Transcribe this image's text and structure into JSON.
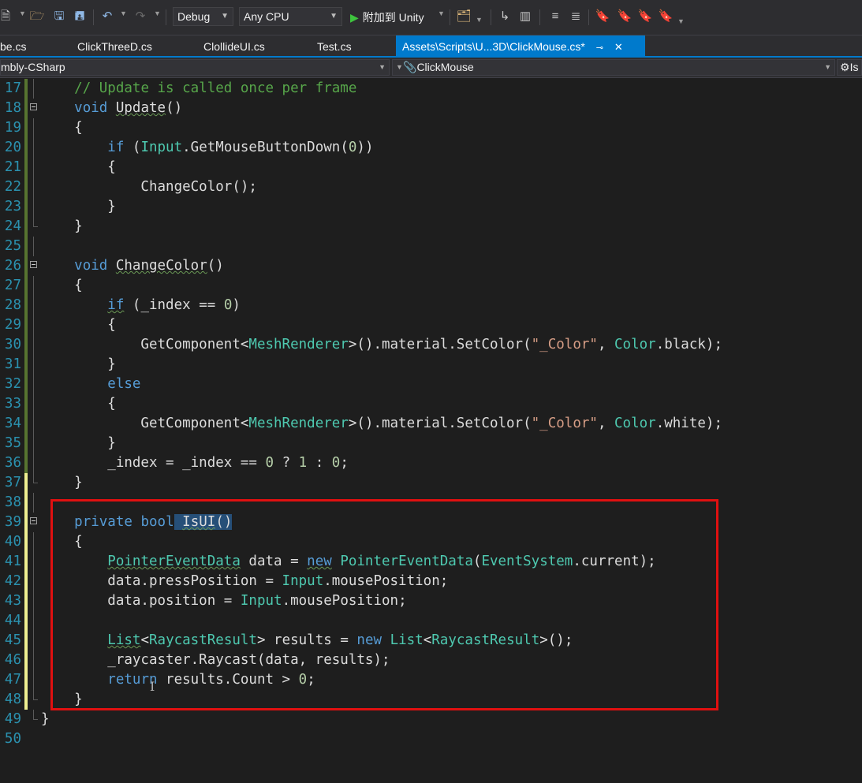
{
  "toolbar": {
    "config": "Debug",
    "platform": "Any CPU",
    "attach_label": "附加到 Unity",
    "icons": [
      "new-project-icon",
      "open-folder-icon",
      "save-icon",
      "save-all-icon",
      "undo-icon",
      "redo-icon",
      "attach-play-icon",
      "device-icon",
      "step-icon",
      "layout-icon",
      "comment-icon",
      "uncomment-icon",
      "bookmark-icon",
      "prev-bookmark-icon",
      "next-bookmark-icon",
      "clear-bookmark-icon"
    ]
  },
  "tabs": [
    {
      "label": "be.cs",
      "active": false
    },
    {
      "label": "ClickThreeD.cs",
      "active": false
    },
    {
      "label": "ClollideUI.cs",
      "active": false
    },
    {
      "label": "Test.cs",
      "active": false
    },
    {
      "label": "Assets\\Scripts\\U...3D\\ClickMouse.cs*",
      "active": true
    }
  ],
  "navbar": {
    "project": "mbly-CSharp",
    "class": "ClickMouse",
    "member": "Is"
  },
  "colors": {
    "background": "#1e1e1e",
    "keyword": "#569cd6",
    "comment": "#57a64a",
    "type": "#4ec9b0",
    "string": "#d69d85",
    "number": "#b5cea8",
    "line_number": "#2b91af",
    "accent": "#007acc",
    "highlight_box": "#e01010"
  },
  "code": [
    {
      "n": "17",
      "change": "saved",
      "fold": false,
      "guide": "line",
      "tokens": [
        {
          "t": "    "
        },
        {
          "t": "// Update is called once per frame",
          "c": "cm"
        }
      ]
    },
    {
      "n": "18",
      "change": "saved",
      "fold": true,
      "guide": "none",
      "tokens": [
        {
          "t": "    "
        },
        {
          "t": "void",
          "c": "kw"
        },
        {
          "t": " "
        },
        {
          "t": "Update",
          "c": "squig"
        },
        {
          "t": "()"
        }
      ]
    },
    {
      "n": "19",
      "change": "saved",
      "fold": false,
      "guide": "line",
      "tokens": [
        {
          "t": "    {"
        }
      ]
    },
    {
      "n": "20",
      "change": "saved",
      "fold": false,
      "guide": "line",
      "tokens": [
        {
          "t": "        "
        },
        {
          "t": "if",
          "c": "kw"
        },
        {
          "t": " ("
        },
        {
          "t": "Input",
          "c": "ty"
        },
        {
          "t": ".GetMouseButtonDown("
        },
        {
          "t": "0",
          "c": "nm"
        },
        {
          "t": "))"
        }
      ]
    },
    {
      "n": "21",
      "change": "saved",
      "fold": false,
      "guide": "line",
      "tokens": [
        {
          "t": "        {"
        }
      ]
    },
    {
      "n": "22",
      "change": "saved",
      "fold": false,
      "guide": "line",
      "tokens": [
        {
          "t": "            ChangeColor();"
        }
      ]
    },
    {
      "n": "23",
      "change": "saved",
      "fold": false,
      "guide": "line",
      "tokens": [
        {
          "t": "        }"
        }
      ]
    },
    {
      "n": "24",
      "change": "saved",
      "fold": false,
      "guide": "end",
      "tokens": [
        {
          "t": "    }"
        }
      ]
    },
    {
      "n": "25",
      "change": "saved",
      "fold": false,
      "guide": "line",
      "tokens": []
    },
    {
      "n": "26",
      "change": "saved",
      "fold": true,
      "guide": "none",
      "tokens": [
        {
          "t": "    "
        },
        {
          "t": "void",
          "c": "kw"
        },
        {
          "t": " "
        },
        {
          "t": "ChangeColor",
          "c": "squig"
        },
        {
          "t": "()"
        }
      ]
    },
    {
      "n": "27",
      "change": "saved",
      "fold": false,
      "guide": "line",
      "tokens": [
        {
          "t": "    {"
        }
      ]
    },
    {
      "n": "28",
      "change": "saved",
      "fold": false,
      "guide": "line",
      "tokens": [
        {
          "t": "        "
        },
        {
          "t": "if",
          "c": "kw squig"
        },
        {
          "t": " (_index == "
        },
        {
          "t": "0",
          "c": "nm"
        },
        {
          "t": ")"
        }
      ]
    },
    {
      "n": "29",
      "change": "saved",
      "fold": false,
      "guide": "line",
      "tokens": [
        {
          "t": "        {"
        }
      ]
    },
    {
      "n": "30",
      "change": "saved",
      "fold": false,
      "guide": "line",
      "tokens": [
        {
          "t": "            GetComponent<"
        },
        {
          "t": "MeshRenderer",
          "c": "ty"
        },
        {
          "t": ">().material.SetColor("
        },
        {
          "t": "\"_Color\"",
          "c": "st"
        },
        {
          "t": ", "
        },
        {
          "t": "Color",
          "c": "ty"
        },
        {
          "t": ".black);"
        }
      ]
    },
    {
      "n": "31",
      "change": "saved",
      "fold": false,
      "guide": "line",
      "tokens": [
        {
          "t": "        }"
        }
      ]
    },
    {
      "n": "32",
      "change": "saved",
      "fold": false,
      "guide": "line",
      "tokens": [
        {
          "t": "        "
        },
        {
          "t": "else",
          "c": "kw"
        }
      ]
    },
    {
      "n": "33",
      "change": "saved",
      "fold": false,
      "guide": "line",
      "tokens": [
        {
          "t": "        {"
        }
      ]
    },
    {
      "n": "34",
      "change": "saved",
      "fold": false,
      "guide": "line",
      "tokens": [
        {
          "t": "            GetComponent<"
        },
        {
          "t": "MeshRenderer",
          "c": "ty"
        },
        {
          "t": ">().material.SetColor("
        },
        {
          "t": "\"_Color\"",
          "c": "st"
        },
        {
          "t": ", "
        },
        {
          "t": "Color",
          "c": "ty"
        },
        {
          "t": ".white);"
        }
      ]
    },
    {
      "n": "35",
      "change": "saved",
      "fold": false,
      "guide": "line",
      "tokens": [
        {
          "t": "        }"
        }
      ]
    },
    {
      "n": "36",
      "change": "saved",
      "fold": false,
      "guide": "line",
      "tokens": [
        {
          "t": "        _index = _index == "
        },
        {
          "t": "0",
          "c": "nm"
        },
        {
          "t": " ? "
        },
        {
          "t": "1",
          "c": "nm"
        },
        {
          "t": " : "
        },
        {
          "t": "0",
          "c": "nm"
        },
        {
          "t": ";"
        }
      ]
    },
    {
      "n": "37",
      "change": "unsaved",
      "fold": false,
      "guide": "end",
      "tokens": [
        {
          "t": "    }"
        }
      ]
    },
    {
      "n": "38",
      "change": "unsaved",
      "fold": false,
      "guide": "line",
      "tokens": []
    },
    {
      "n": "39",
      "change": "unsaved",
      "fold": true,
      "guide": "none",
      "tokens": [
        {
          "t": "    "
        },
        {
          "t": "private",
          "c": "kw"
        },
        {
          "t": " "
        },
        {
          "t": "bool",
          "c": "kw"
        },
        {
          "t": " ",
          "c": "sel"
        },
        {
          "t": "IsUI",
          "c": "sel squig"
        },
        {
          "t": "()",
          "c": "sel"
        }
      ]
    },
    {
      "n": "40",
      "change": "unsaved",
      "fold": false,
      "guide": "line",
      "tokens": [
        {
          "t": "    {"
        }
      ]
    },
    {
      "n": "41",
      "change": "unsaved",
      "fold": false,
      "guide": "line",
      "tokens": [
        {
          "t": "        "
        },
        {
          "t": "PointerEventData",
          "c": "ty squig"
        },
        {
          "t": " data = "
        },
        {
          "t": "new",
          "c": "kw squig"
        },
        {
          "t": " "
        },
        {
          "t": "PointerEventData",
          "c": "ty"
        },
        {
          "t": "("
        },
        {
          "t": "EventSystem",
          "c": "ty"
        },
        {
          "t": ".current);"
        }
      ]
    },
    {
      "n": "42",
      "change": "unsaved",
      "fold": false,
      "guide": "line",
      "tokens": [
        {
          "t": "        data.pressPosition = "
        },
        {
          "t": "Input",
          "c": "ty"
        },
        {
          "t": ".mousePosition;"
        }
      ]
    },
    {
      "n": "43",
      "change": "unsaved",
      "fold": false,
      "guide": "line",
      "tokens": [
        {
          "t": "        data.position = "
        },
        {
          "t": "Input",
          "c": "ty"
        },
        {
          "t": ".mousePosition;"
        }
      ]
    },
    {
      "n": "44",
      "change": "unsaved",
      "fold": false,
      "guide": "line",
      "tokens": []
    },
    {
      "n": "45",
      "change": "unsaved",
      "fold": false,
      "guide": "line",
      "tokens": [
        {
          "t": "        "
        },
        {
          "t": "List",
          "c": "ty squig"
        },
        {
          "t": "<"
        },
        {
          "t": "RaycastResult",
          "c": "ty"
        },
        {
          "t": "> results = "
        },
        {
          "t": "new",
          "c": "kw"
        },
        {
          "t": " "
        },
        {
          "t": "List",
          "c": "ty"
        },
        {
          "t": "<"
        },
        {
          "t": "RaycastResult",
          "c": "ty"
        },
        {
          "t": ">();"
        }
      ]
    },
    {
      "n": "46",
      "change": "unsaved",
      "fold": false,
      "guide": "line",
      "tokens": [
        {
          "t": "        _raycaster.Raycast(data, results);"
        }
      ]
    },
    {
      "n": "47",
      "change": "unsaved",
      "fold": false,
      "guide": "line",
      "tokens": [
        {
          "t": "        "
        },
        {
          "t": "return",
          "c": "kw"
        },
        {
          "t": " results.Count > "
        },
        {
          "t": "0",
          "c": "nm"
        },
        {
          "t": ";"
        }
      ]
    },
    {
      "n": "48",
      "change": "unsaved",
      "fold": false,
      "guide": "end",
      "tokens": [
        {
          "t": "    }"
        }
      ]
    },
    {
      "n": "49",
      "change": "none",
      "fold": false,
      "guide": "end",
      "tokens": [
        {
          "t": "}"
        }
      ]
    },
    {
      "n": "50",
      "change": "none",
      "fold": false,
      "guide": "none",
      "tokens": []
    }
  ]
}
